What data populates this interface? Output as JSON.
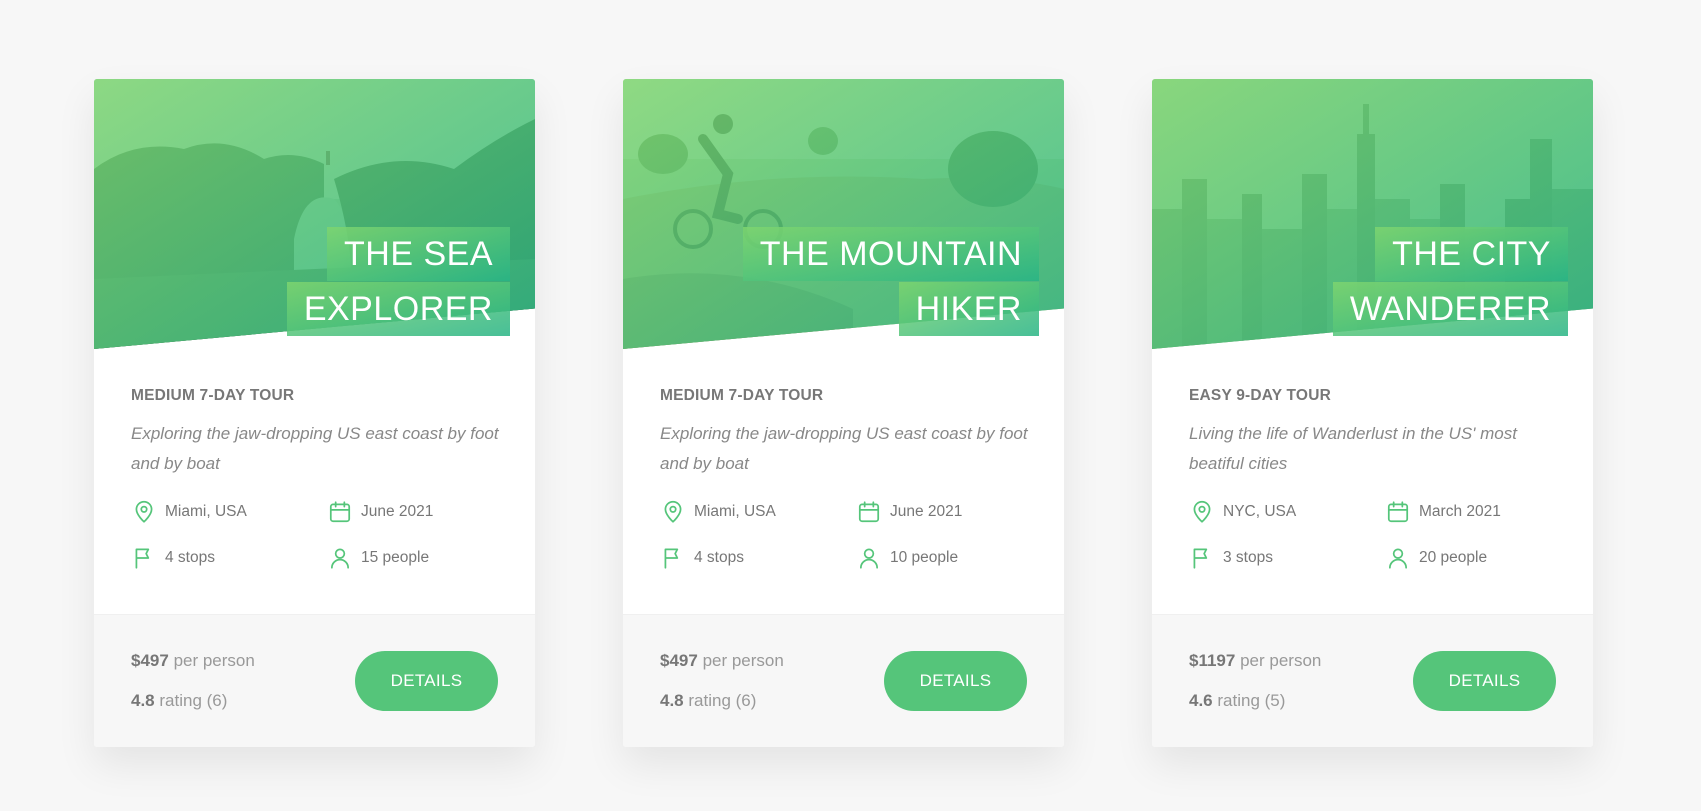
{
  "colors": {
    "primary": "#55c57a",
    "primary_light": "#7ed56f",
    "primary_dark": "#28b485",
    "text": "#777777",
    "background": "#f7f7f7"
  },
  "cards": [
    {
      "title_lines": [
        "THE SEA",
        "EXPLORER"
      ],
      "hero_image": "sea-cliff-arch-image",
      "level": "MEDIUM 7-DAY TOUR",
      "description": "Exploring the jaw-dropping US east coast by foot and by boat",
      "location": "Miami, USA",
      "date": "June 2021",
      "stops": "4 stops",
      "people": "15 people",
      "price": "$497",
      "price_suffix": "per person",
      "rating": "4.8",
      "rating_suffix": "rating (6)",
      "button_label": "DETAILS"
    },
    {
      "title_lines": [
        "THE MOUNTAIN",
        "HIKER"
      ],
      "hero_image": "mountain-biker-image",
      "level": "MEDIUM 7-DAY TOUR",
      "description": "Exploring the jaw-dropping US east coast by foot and by boat",
      "location": "Miami, USA",
      "date": "June 2021",
      "stops": "4 stops",
      "people": "10 people",
      "price": "$497",
      "price_suffix": "per person",
      "rating": "4.8",
      "rating_suffix": "rating (6)",
      "button_label": "DETAILS"
    },
    {
      "title_lines": [
        "THE CITY",
        "WANDERER"
      ],
      "hero_image": "city-skyline-image",
      "level": "EASY 9-DAY TOUR",
      "description": "Living the life of Wanderlust in the US' most beatiful cities",
      "location": "NYC, USA",
      "date": "March 2021",
      "stops": "3 stops",
      "people": "20 people",
      "price": "$1197",
      "price_suffix": "per person",
      "rating": "4.6",
      "rating_suffix": "rating (5)",
      "button_label": "DETAILS"
    }
  ],
  "icons": {
    "location": "map-pin-icon",
    "date": "calendar-icon",
    "stops": "flag-icon",
    "people": "user-icon"
  }
}
